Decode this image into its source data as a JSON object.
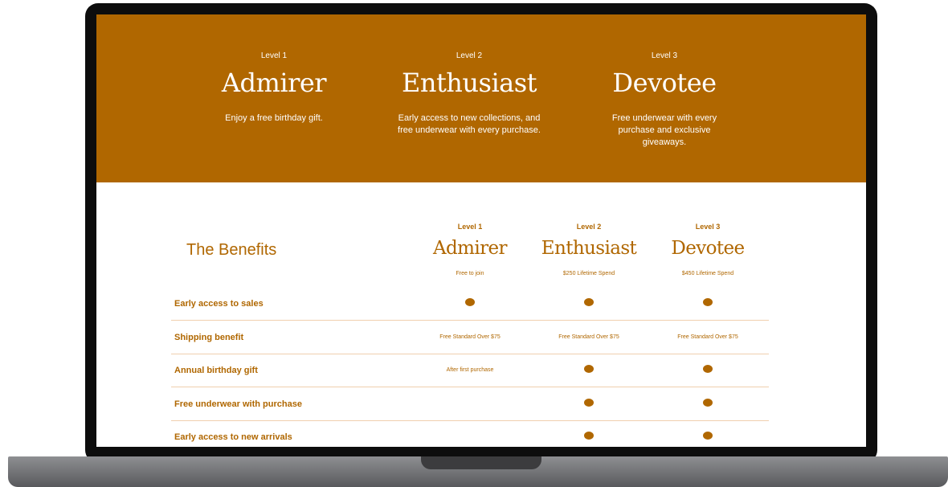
{
  "hero": {
    "tiers": [
      {
        "level": "Level 1",
        "name": "Admirer",
        "description": "Enjoy a free birthday gift."
      },
      {
        "level": "Level 2",
        "name": "Enthusiast",
        "description": "Early access to new collections, and free underwear with every purchase."
      },
      {
        "level": "Level 3",
        "name": "Devotee",
        "description": "Free underwear with every purchase and exclusive giveaways."
      }
    ]
  },
  "benefits": {
    "title": "The Benefits",
    "columns": [
      {
        "level": "Level 1",
        "name": "Admirer",
        "spend": "Free to join"
      },
      {
        "level": "Level 2",
        "name": "Enthusiast",
        "spend": "$250 Lifetime Spend"
      },
      {
        "level": "Level 3",
        "name": "Devotee",
        "spend": "$450 Lifetime Spend"
      }
    ],
    "rows": [
      {
        "label": "Early access to sales",
        "cells": [
          "dot",
          "dot",
          "dot"
        ]
      },
      {
        "label": "Shipping benefit",
        "cells": [
          "Free Standard Over $75",
          "Free Standard Over $75",
          "Free Standard Over $75"
        ]
      },
      {
        "label": "Annual birthday gift",
        "cells": [
          "After first purchase",
          "dot",
          "dot"
        ]
      },
      {
        "label": "Free underwear with purchase",
        "cells": [
          "",
          "dot",
          "dot"
        ]
      },
      {
        "label": "Early access to new arrivals",
        "cells": [
          "",
          "dot",
          "dot"
        ]
      }
    ]
  },
  "colors": {
    "accent": "#b06700",
    "divider": "#f0cfae"
  }
}
